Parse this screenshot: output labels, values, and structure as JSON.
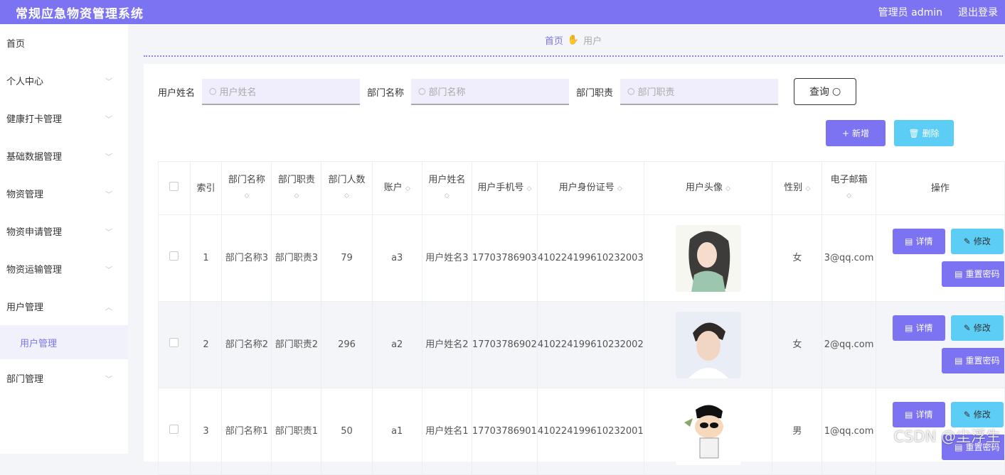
{
  "app": {
    "title": "常规应急物资管理系统",
    "user_label": "管理员 admin",
    "logout": "退出登录"
  },
  "sidebar": {
    "items": [
      {
        "label": "首页"
      },
      {
        "label": "个人中心"
      },
      {
        "label": "健康打卡管理"
      },
      {
        "label": "基础数据管理"
      },
      {
        "label": "物资管理"
      },
      {
        "label": "物资申请管理"
      },
      {
        "label": "物资运输管理"
      },
      {
        "label": "用户管理"
      },
      {
        "label": "用户管理"
      },
      {
        "label": "部门管理"
      }
    ]
  },
  "breadcrumb": {
    "home": "首页",
    "current": "用户"
  },
  "search": {
    "fields": [
      {
        "label": "用户姓名",
        "placeholder": "用户姓名"
      },
      {
        "label": "部门名称",
        "placeholder": "部门名称"
      },
      {
        "label": "部门职责",
        "placeholder": "部门职责"
      }
    ],
    "query_label": "查询"
  },
  "actions": {
    "add_label": "新增",
    "delete_label": "删除"
  },
  "table": {
    "headers": [
      "索引",
      "部门名称",
      "部门职责",
      "部门人数",
      "账户",
      "用户姓名",
      "用户手机号",
      "用户身份证号",
      "用户头像",
      "性别",
      "电子邮箱",
      "操作"
    ],
    "rows": [
      {
        "index": "1",
        "dept_name": "部门名称3",
        "dept_duty": "部门职责3",
        "dept_count": "79",
        "account": "a3",
        "user_name": "用户姓名3",
        "phone": "17703786903",
        "id_card": "410224199610232003",
        "gender": "女",
        "email": "3@qq.com"
      },
      {
        "index": "2",
        "dept_name": "部门名称2",
        "dept_duty": "部门职责2",
        "dept_count": "296",
        "account": "a2",
        "user_name": "用户姓名2",
        "phone": "17703786902",
        "id_card": "410224199610232002",
        "gender": "女",
        "email": "2@qq.com"
      },
      {
        "index": "3",
        "dept_name": "部门名称1",
        "dept_duty": "部门职责1",
        "dept_count": "50",
        "account": "a1",
        "user_name": "用户姓名1",
        "phone": "17703786901",
        "id_card": "410224199610232001",
        "gender": "男",
        "email": "1@qq.com"
      }
    ],
    "row_actions": {
      "detail": "详情",
      "edit": "修改",
      "reset": "重置密码"
    }
  },
  "watermark": "CSDN @尘浮生"
}
